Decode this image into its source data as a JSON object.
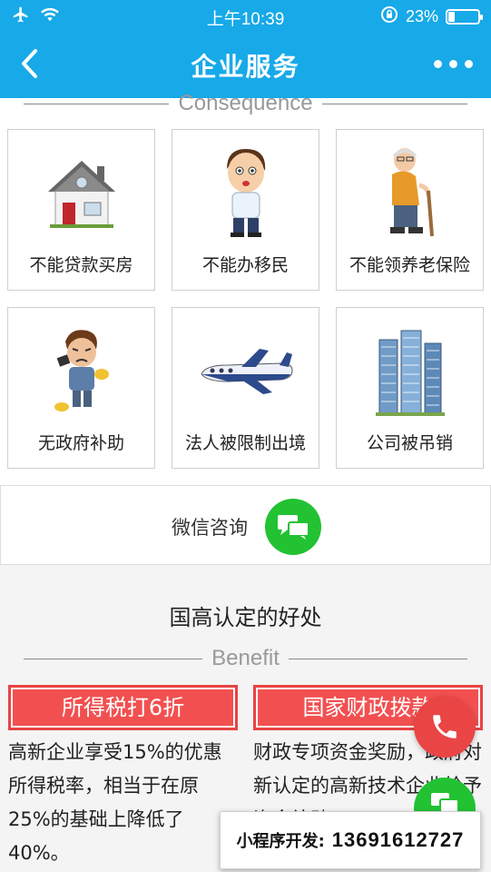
{
  "status_bar": {
    "time": "上午10:39",
    "battery": "23%",
    "battery_level": 0.23
  },
  "nav": {
    "title": "企业服务"
  },
  "consequence": {
    "heading": "Consequence",
    "items": [
      {
        "label": "不能贷款买房",
        "icon": "house-icon"
      },
      {
        "label": "不能办移民",
        "icon": "cartoon-man-icon"
      },
      {
        "label": "不能领养老保险",
        "icon": "elderly-man-icon"
      },
      {
        "label": "无政府补助",
        "icon": "worried-man-icon"
      },
      {
        "label": "法人被限制出境",
        "icon": "airplane-icon"
      },
      {
        "label": "公司被吊销",
        "icon": "buildings-icon"
      }
    ]
  },
  "wechat": {
    "label": "微信咨询",
    "icon": "chat-bubbles-icon"
  },
  "benefit": {
    "title": "国高认定的好处",
    "heading": "Benefit",
    "items": [
      {
        "title": "所得税打6折",
        "text": "高新企业享受15%的优惠所得税率，相当于在原25%的基础上降低了40%。"
      },
      {
        "title": "国家财政拨款",
        "text": "财政专项资金奖励，政府对新认定的高新技术企业给予资金补贴"
      }
    ]
  },
  "floating": {
    "phone_icon": "phone-icon",
    "chat_icon": "chat-icon",
    "promo_label": "小程序开发:",
    "promo_phone": "13691612727"
  },
  "colors": {
    "primary": "#17a9e8",
    "accent_red": "#f25050",
    "wechat_green": "#22c233"
  }
}
